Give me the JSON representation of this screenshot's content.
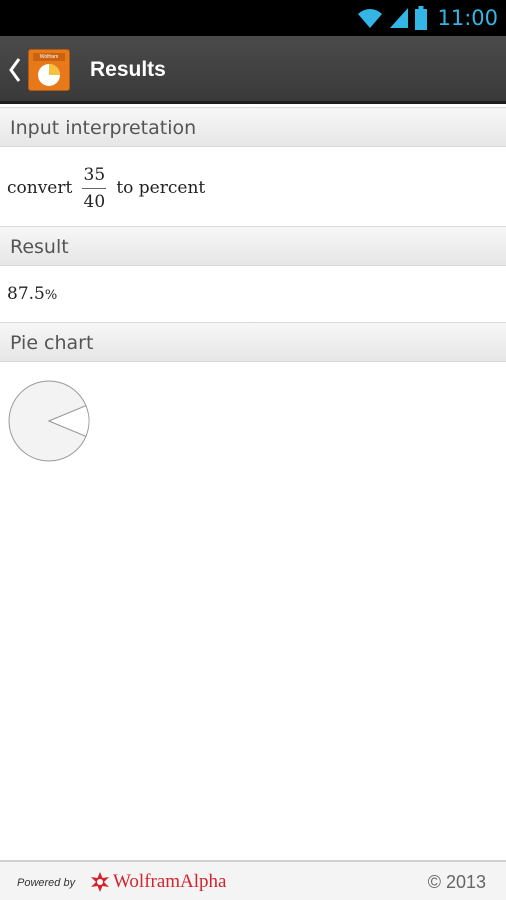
{
  "status_bar": {
    "time": "11:00",
    "icons": [
      "wifi-icon",
      "cell-signal-icon",
      "battery-icon"
    ],
    "accent_color": "#33b5e5"
  },
  "action_bar": {
    "title": "Results",
    "app_icon_tag": "Wolfram",
    "app_icon_color": "#e8791a"
  },
  "pods": {
    "input": {
      "header": "Input interpretation",
      "prefix": "convert",
      "numerator": "35",
      "denominator": "40",
      "suffix": "to percent"
    },
    "result": {
      "header": "Result",
      "value": "87.5",
      "unit": "%"
    },
    "pie": {
      "header": "Pie chart"
    }
  },
  "chart_data": {
    "type": "pie",
    "values": [
      87.5,
      12.5
    ],
    "title": ""
  },
  "footer": {
    "powered_by": "Powered by",
    "brand": "WolframAlpha",
    "copyright": "© 2013"
  }
}
